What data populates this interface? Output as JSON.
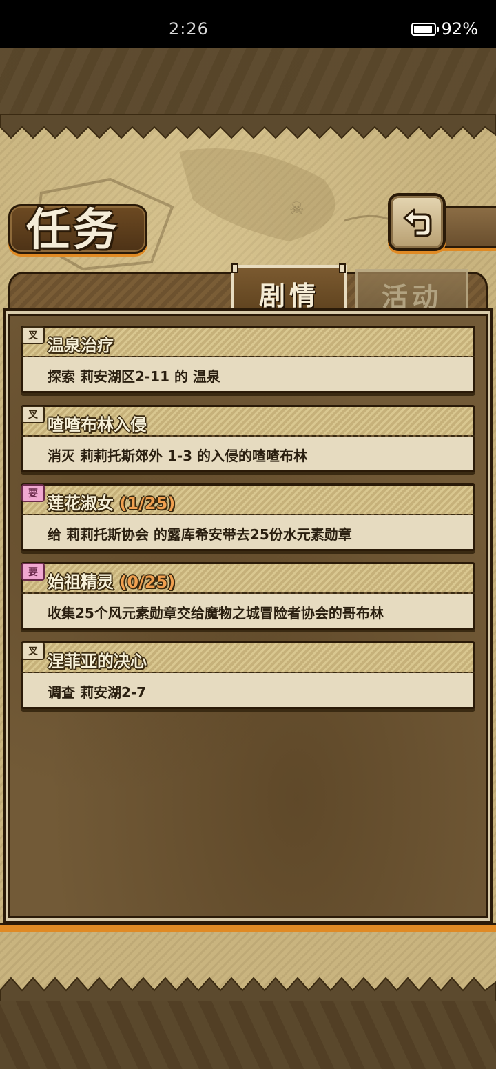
{
  "status_bar": {
    "time": "2:26",
    "battery": "92%"
  },
  "page": {
    "title": "任务"
  },
  "tabs": [
    {
      "label": "剧情",
      "active": true
    },
    {
      "label": "活动",
      "active": false
    }
  ],
  "quests": [
    {
      "icon": "story-quest-icon",
      "icon_text": "叉",
      "title": "温泉治疗",
      "progress": "",
      "description": "探索 莉安湖区2-11 的 温泉"
    },
    {
      "icon": "story-quest-icon",
      "icon_text": "叉",
      "title": "喳喳布林入侵",
      "progress": "",
      "description": "消灭 莉莉托斯郊外 1-3 的入侵的喳喳布林"
    },
    {
      "icon": "request-quest-icon",
      "icon_text": "要",
      "title": "莲花淑女 ",
      "progress": "(1/25)",
      "description": "给 莉莉托斯协会 的露库希安带去25份水元素勋章"
    },
    {
      "icon": "request-quest-icon",
      "icon_text": "要",
      "title": "始祖精灵 ",
      "progress": "(0/25)",
      "description": "收集25个风元素勋章交给魔物之城冒险者协会的哥布林"
    },
    {
      "icon": "story-quest-icon",
      "icon_text": "叉",
      "title": "涅菲亚的决心",
      "progress": "",
      "description": "调查 莉安湖2-7"
    }
  ]
}
